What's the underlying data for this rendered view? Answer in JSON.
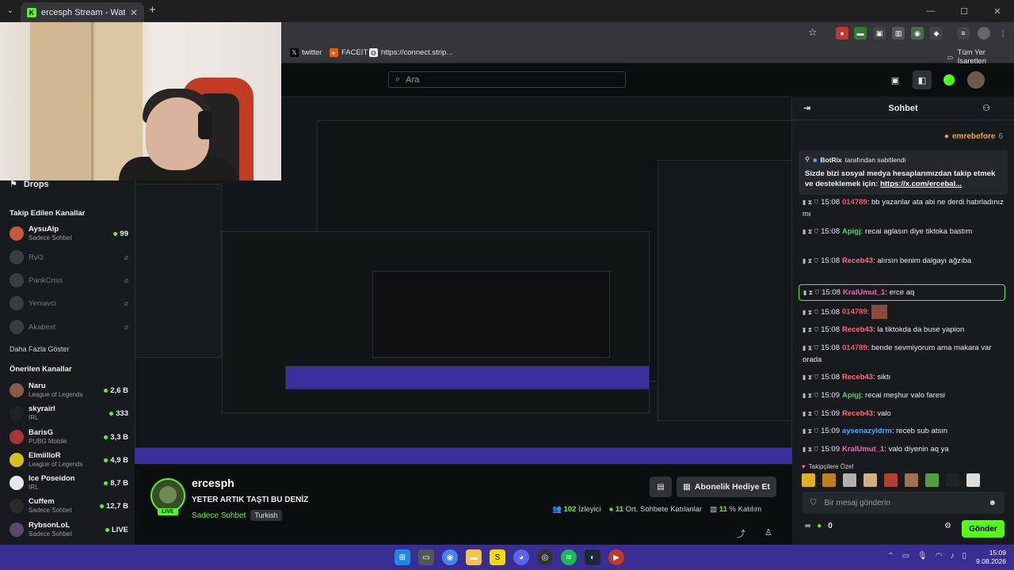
{
  "browser": {
    "tab_title": "ercesph Stream - Watch Live on Kick",
    "bookmarks": [
      "twitter",
      "FACEIT",
      "https://connect.strip..."
    ],
    "all_bookmarks": "Tüm Yer İşaretleri"
  },
  "header": {
    "search_placeholder": "Ara"
  },
  "sidebar": {
    "drops": "Drops",
    "followed_heading": "Takip Edilen Kanallar",
    "followed": [
      {
        "name": "AysuAlp",
        "sub": "Sadece Sohbet",
        "count": "99",
        "live": true
      },
      {
        "name": "Rvl3",
        "sub": "",
        "count": "",
        "live": false
      },
      {
        "name": "PankCriss",
        "sub": "",
        "count": "",
        "live": false
      },
      {
        "name": "Yeniavci",
        "sub": "",
        "count": "",
        "live": false
      },
      {
        "name": "Akabest",
        "sub": "",
        "count": "",
        "live": false
      }
    ],
    "show_more": "Daha Fazla Göster",
    "recommended_heading": "Önerilen Kanallar",
    "recommended": [
      {
        "name": "Naru",
        "sub": "League of Legends",
        "count": "2,6 B"
      },
      {
        "name": "skyrairl",
        "sub": "IRL",
        "count": "333"
      },
      {
        "name": "BarisG",
        "sub": "PUBG Mobile",
        "count": "3,3 B"
      },
      {
        "name": "ElmiilloR",
        "sub": "League of Legends",
        "count": "4,9 B"
      },
      {
        "name": "Ice Poseidon",
        "sub": "IRL",
        "count": "8,7 B"
      },
      {
        "name": "Cuffem",
        "sub": "Sadece Sohbet",
        "count": "12,7 B"
      },
      {
        "name": "RybsonLoL",
        "sub": "Sadece Sohbet",
        "count": "LIVE"
      }
    ]
  },
  "stream": {
    "channel": "ercesph",
    "live_badge": "LIVE",
    "title": "YETER ARTIK TAŞTI BU DENİZ",
    "category": "Sadece Sohbet",
    "tag": "Turkish",
    "gift_button": "Abonelik Hediye Et",
    "viewers": "102",
    "viewers_label": "İzleyici",
    "chatters": "11",
    "chatters_label": "Ort. Sohbete Katılanlar",
    "participation": "11",
    "participation_label": "% Katılım"
  },
  "chat": {
    "title": "Sohbet",
    "top_donor": "emrebefore",
    "top_donor_count": "6",
    "pinned_by": "BotRix",
    "pinned_suffix": "tarafından sabitlendi",
    "pinned_text": "Sizde bizi sosyal medya hesaplarımızdan takip etmek ve desteklemek için: ",
    "pinned_link": "https://x.com/ercebal...",
    "messages": [
      {
        "time": "15:08",
        "user": "014789",
        "color": "#ff4f6a",
        "text": ": bb yazanlar ata abi ne derdi hatırladınız mı"
      },
      {
        "time": "15:08",
        "user": "Apigj",
        "color": "#4fd36a",
        "text": ": recai aglasın diye tiktoka bastım"
      },
      {
        "time": "15:08",
        "user": "Receb43",
        "color": "#ff6b7d",
        "text": ": alırsın benim dalgayı ağzıba"
      },
      {
        "time": "15:08",
        "user": "KralUmut_1",
        "color": "#ff5cc8",
        "text": ": erce aq"
      },
      {
        "time": "15:08",
        "user": "014789",
        "color": "#ff4f6a",
        "text": ":"
      },
      {
        "time": "15:08",
        "user": "Receb43",
        "color": "#ff6b7d",
        "text": ": la tiktokda da buse yapion"
      },
      {
        "time": "15:08",
        "user": "014789",
        "color": "#ff4f6a",
        "text": ": bende sevmiyorum ama makara var orada"
      },
      {
        "time": "15:08",
        "user": "Receb43",
        "color": "#ff6b7d",
        "text": ": siktı"
      },
      {
        "time": "15:09",
        "user": "Apigj",
        "color": "#4fd36a",
        "text": ": recai meşhur valo faresi"
      },
      {
        "time": "15:09",
        "user": "Receb43",
        "color": "#ff6b7d",
        "text": ": valo"
      },
      {
        "time": "15:09",
        "user": "aysenazyldrm",
        "color": "#4aa8ff",
        "text": ": receb sub atsın"
      },
      {
        "time": "15:09",
        "user": "KralUmut_1",
        "color": "#ff5cc8",
        "text": ": valo diyenin aq ya"
      }
    ],
    "subs_label": "Takipçilere Özel",
    "input_placeholder": "Bir mesaj gönderin",
    "points": "0",
    "send": "Gönder"
  },
  "taskbar": {
    "time": "15:09",
    "date": "9.08.2026"
  },
  "colors": {
    "kick_green": "#53fc18",
    "bg": "#0b0e0f",
    "panel": "#181b1d",
    "taskbar": "#3a2d92"
  }
}
